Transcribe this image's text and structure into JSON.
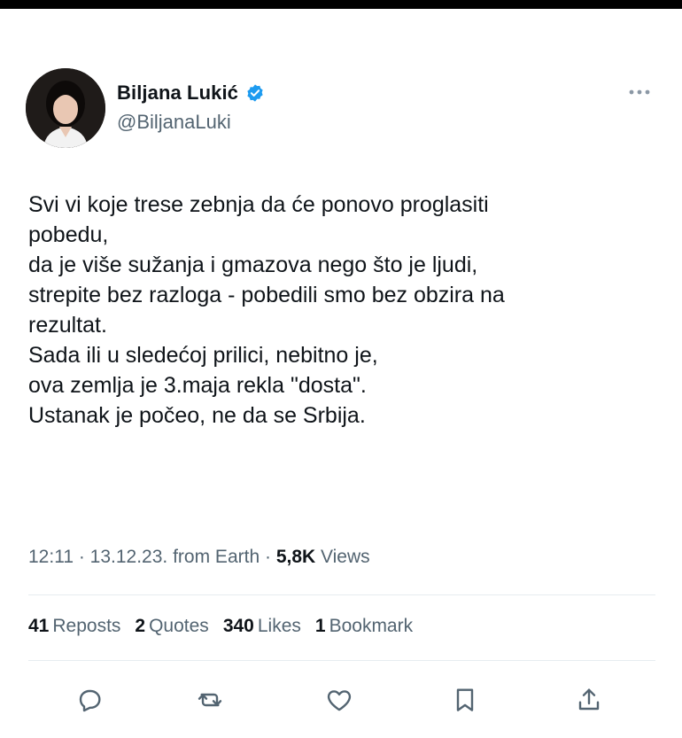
{
  "author": {
    "display_name": "Biljana Lukić",
    "handle": "@BiljanaLuki",
    "verified": true
  },
  "tweet": {
    "text": "Svi vi koje trese zebnja da će ponovo proglasiti\npobedu,\nda je više sužanja i gmazova nego što je ljudi,\nstrepite bez razloga - pobedili smo bez obzira na\nrezultat.\nSada ili u sledećoj prilici, nebitno je,\nova zemlja je 3.maja rekla \"dosta\".\nUstanak je počeo, ne da se Srbija."
  },
  "meta": {
    "time": "12:11",
    "sep1": " · ",
    "date": "13.12.23.",
    "source": " from Earth",
    "sep2": " · ",
    "views_count": "5,8K",
    "views_label": " Views"
  },
  "stats": {
    "reposts_count": "41",
    "reposts_label": "Reposts",
    "quotes_count": "2",
    "quotes_label": "Quotes",
    "likes_count": "340",
    "likes_label": "Likes",
    "bookmarks_count": "1",
    "bookmarks_label": "Bookmark"
  },
  "icons": {
    "more": "more-horizontal-icon",
    "verified": "verified-badge-icon",
    "reply": "reply-icon",
    "repost": "repost-icon",
    "like": "heart-icon",
    "bookmark": "bookmark-icon",
    "share": "share-icon"
  },
  "colors": {
    "text": "#0f1419",
    "secondary": "#536471",
    "verified": "#1d9bf0",
    "topbar": "#000000"
  }
}
